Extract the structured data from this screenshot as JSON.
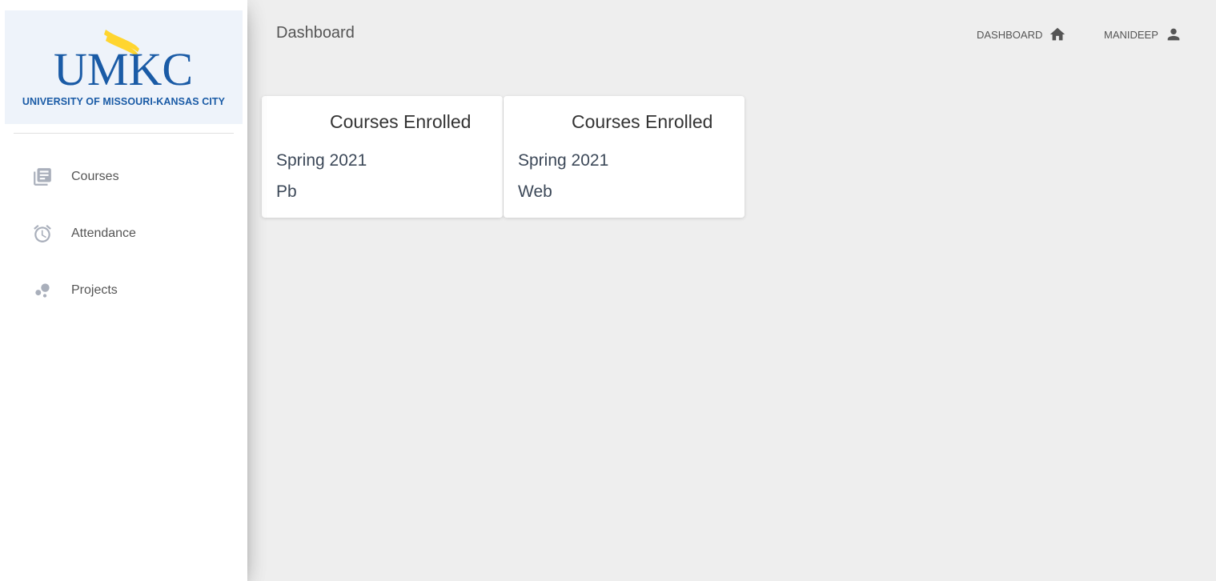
{
  "sidebar": {
    "logo": {
      "wordmark": "UMKC",
      "subtitle": "UNIVERSITY OF MISSOURI-KANSAS CITY"
    },
    "items": [
      {
        "label": "Courses",
        "icon": "library-books-icon"
      },
      {
        "label": "Attendance",
        "icon": "alarm-icon"
      },
      {
        "label": "Projects",
        "icon": "bubble-chart-icon"
      }
    ]
  },
  "header": {
    "title": "Dashboard",
    "dashboard_label": "Dashboard",
    "user_label": "Manideep"
  },
  "cards": [
    {
      "title": "Courses Enrolled",
      "term": "Spring 2021",
      "course": "Pb"
    },
    {
      "title": "Courses Enrolled",
      "term": "Spring 2021",
      "course": "Web"
    }
  ],
  "colors": {
    "brand_blue": "#1a5ba6",
    "brand_gold": "#ffd52f",
    "background": "#eeeeee"
  }
}
